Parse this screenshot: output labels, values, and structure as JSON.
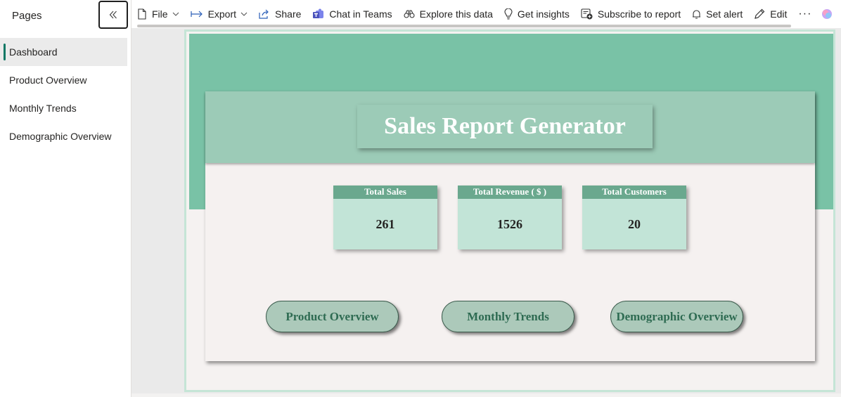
{
  "pages_pane": {
    "title": "Pages",
    "items": [
      {
        "label": "Dashboard",
        "active": true
      },
      {
        "label": "Product Overview",
        "active": false
      },
      {
        "label": "Monthly Trends",
        "active": false
      },
      {
        "label": "Demographic Overview",
        "active": false
      }
    ]
  },
  "toolbar": {
    "file": "File",
    "export": "Export",
    "share": "Share",
    "chat_in_teams": "Chat in Teams",
    "explore": "Explore this data",
    "insights": "Get insights",
    "subscribe": "Subscribe to report",
    "set_alert": "Set alert",
    "edit": "Edit",
    "more": "···"
  },
  "report": {
    "title": "Sales Report Generator",
    "kpis": [
      {
        "label": "Total Sales",
        "value": "261"
      },
      {
        "label": "Total Revenue ( $ )",
        "value": "1526"
      },
      {
        "label": "Total Customers",
        "value": "20"
      }
    ],
    "nav_buttons": [
      {
        "label": "Product Overview"
      },
      {
        "label": "Monthly Trends"
      },
      {
        "label": "Demographic Overview"
      }
    ]
  },
  "colors": {
    "accent": "#117865",
    "banner": "#79c2a6",
    "header_band": "#9ccbb7",
    "kpi_card": "#c2e4d7",
    "kpi_header": "#6aa88e",
    "nav_button": "#acc9ba",
    "nav_button_text": "#2e6b52",
    "page_background": "#f5f2f1"
  }
}
